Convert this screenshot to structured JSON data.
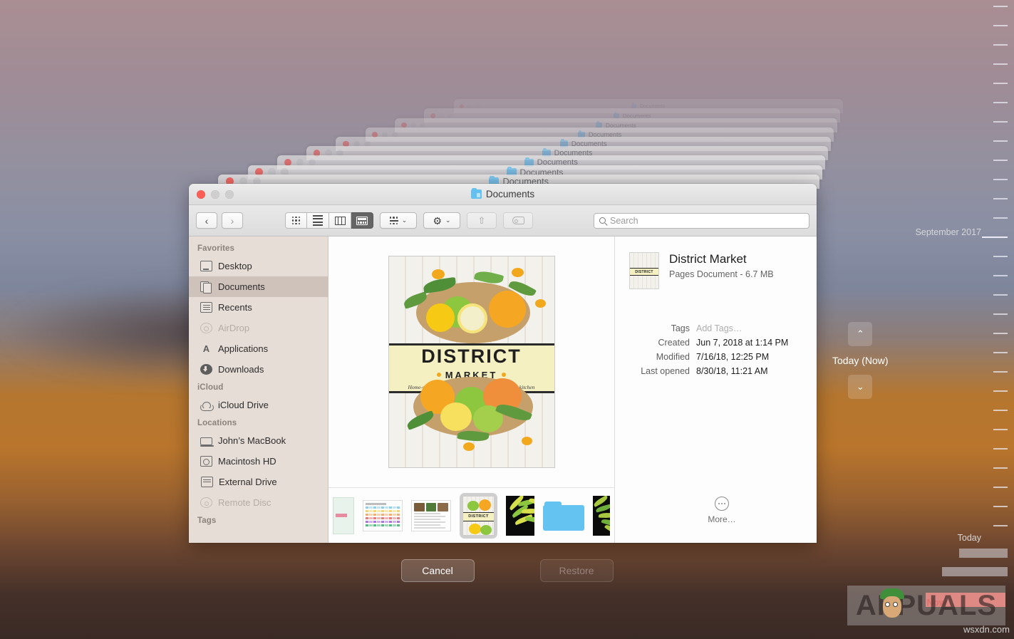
{
  "window": {
    "title": "Documents",
    "folder_icon": "folder-icon",
    "traffic": {
      "close": "close-button",
      "minimize": "minimize-button",
      "zoom": "zoom-button"
    }
  },
  "toolbar": {
    "back_label": "‹",
    "forward_label": "›",
    "views": [
      {
        "name": "icon-view",
        "label": "icon-view-icon",
        "active": false
      },
      {
        "name": "list-view",
        "label": "list-view-icon",
        "active": false
      },
      {
        "name": "column-view",
        "label": "column-view-icon",
        "active": false
      },
      {
        "name": "gallery-view",
        "label": "gallery-view-icon",
        "active": true
      }
    ],
    "group_label": "group-by-icon",
    "action_label": "⚙",
    "share_label": "⇧",
    "tag_label": "tag-icon",
    "chevron": "⌄"
  },
  "search": {
    "placeholder": "Search",
    "value": ""
  },
  "sidebar": {
    "sections": [
      {
        "header": "Favorites",
        "items": [
          {
            "label": "Desktop",
            "icon": "desktop-icon",
            "selected": false,
            "disabled": false
          },
          {
            "label": "Documents",
            "icon": "documents-icon",
            "selected": true,
            "disabled": false
          },
          {
            "label": "Recents",
            "icon": "recents-icon",
            "selected": false,
            "disabled": false
          },
          {
            "label": "AirDrop",
            "icon": "airdrop-icon",
            "selected": false,
            "disabled": true
          },
          {
            "label": "Applications",
            "icon": "applications-icon",
            "selected": false,
            "disabled": false
          },
          {
            "label": "Downloads",
            "icon": "downloads-icon",
            "selected": false,
            "disabled": false
          }
        ]
      },
      {
        "header": "iCloud",
        "items": [
          {
            "label": "iCloud Drive",
            "icon": "icloud-drive-icon",
            "selected": false,
            "disabled": false
          }
        ]
      },
      {
        "header": "Locations",
        "items": [
          {
            "label": "John’s MacBook",
            "icon": "laptop-icon",
            "selected": false,
            "disabled": false
          },
          {
            "label": "Macintosh HD",
            "icon": "harddisk-icon",
            "selected": false,
            "disabled": false
          },
          {
            "label": "External Drive",
            "icon": "external-drive-icon",
            "selected": false,
            "disabled": false
          },
          {
            "label": "Remote Disc",
            "icon": "remote-disc-icon",
            "selected": false,
            "disabled": true
          }
        ]
      },
      {
        "header": "Tags",
        "items": []
      }
    ]
  },
  "preview": {
    "poster": {
      "title": "DISTRICT",
      "subtitle": "MARKET",
      "tagline": "Home-style prepared foods and necessities for your kitchen"
    },
    "filmstrip": [
      {
        "name": "document-green",
        "type": "doc-partial"
      },
      {
        "name": "spreadsheet",
        "type": "sheet"
      },
      {
        "name": "recipe-document",
        "type": "doc"
      },
      {
        "name": "district-market-poster",
        "type": "poster",
        "selected": true,
        "label": "DISTRICT"
      },
      {
        "name": "plant-photo",
        "type": "photo"
      },
      {
        "name": "folder",
        "type": "folder"
      },
      {
        "name": "plant-photo-edge",
        "type": "photo-partial"
      }
    ]
  },
  "info": {
    "name": "District Market",
    "subtitle": "Pages Document - 6.7 MB",
    "thumb_label": "DISTRICT",
    "fields": [
      {
        "key": "Tags",
        "value": "Add Tags…",
        "placeholder": true
      },
      {
        "key": "Created",
        "value": "Jun 7, 2018 at 1:14 PM",
        "placeholder": false
      },
      {
        "key": "Modified",
        "value": "7/16/18, 12:25 PM",
        "placeholder": false
      },
      {
        "key": "Last opened",
        "value": "8/30/18, 11:21 AM",
        "placeholder": false
      }
    ],
    "more_label": "More…",
    "more_icon": "ellipsis-circle-icon"
  },
  "actions": {
    "cancel": "Cancel",
    "restore": "Restore"
  },
  "timeline": {
    "month_label": "September 2017",
    "today_now_label": "Today (Now)",
    "today_label": "Today",
    "now_label": "Now",
    "up_arrow": "⌃",
    "down_arrow": "⌄"
  },
  "stack": {
    "window_title": "Documents",
    "count": 9
  },
  "watermark": {
    "text": "APPUALS",
    "site": "wsxdn.com"
  },
  "colors": {
    "sidebar_bg": "#e6ddd7",
    "selected_row": "#cfc2ba",
    "accent_folder": "#63c0ef",
    "now_red": "#f9423a",
    "band_yellow": "#f4f0c2"
  }
}
